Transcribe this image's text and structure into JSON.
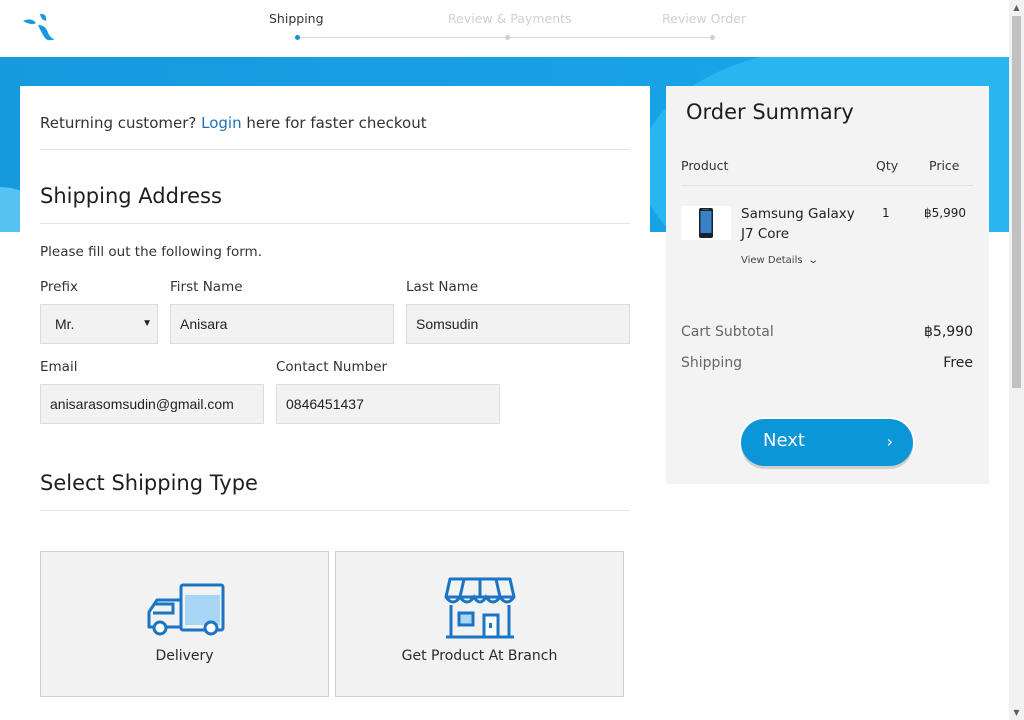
{
  "header": {
    "steps": [
      {
        "label": "Shipping",
        "active": true
      },
      {
        "label": "Review & Payments",
        "active": false
      },
      {
        "label": "Review Order",
        "active": false
      }
    ]
  },
  "checkout": {
    "returning_prefix": "Returning customer?",
    "login_link": "Login",
    "returning_suffix": "here for faster checkout",
    "shipping_address_title": "Shipping Address",
    "form_hint": "Please fill out the following form.",
    "fields": {
      "prefix_label": "Prefix",
      "prefix_value": "Mr.",
      "first_name_label": "First Name",
      "first_name_value": "Anisara",
      "last_name_label": "Last Name",
      "last_name_value": "Somsudin",
      "email_label": "Email",
      "email_value": "anisarasomsudin@gmail.com",
      "contact_label": "Contact Number",
      "contact_value": "0846451437"
    },
    "shipping_type_title": "Select Shipping Type",
    "shipping_options": [
      {
        "label": "Delivery",
        "icon": "delivery-truck-icon"
      },
      {
        "label": "Get Product At Branch",
        "icon": "store-icon"
      }
    ]
  },
  "summary": {
    "title": "Order Summary",
    "columns": {
      "product": "Product",
      "qty": "Qty",
      "price": "Price"
    },
    "item": {
      "name": "Samsung Galaxy J7 Core",
      "qty": "1",
      "price": "฿5,990",
      "view_details": "View Details"
    },
    "subtotal_label": "Cart Subtotal",
    "subtotal_value": "฿5,990",
    "shipping_label": "Shipping",
    "shipping_value": "Free",
    "next_label": "Next"
  },
  "colors": {
    "brand_blue": "#1799de",
    "button_blue": "#0b96d8",
    "link_blue": "#1e72b8"
  }
}
